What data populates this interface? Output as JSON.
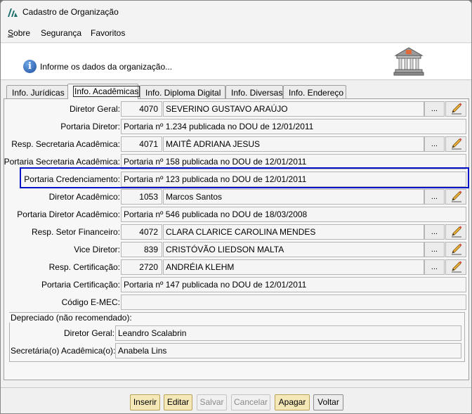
{
  "window": {
    "title": "Cadastro de Organização"
  },
  "menu": [
    "Sobre",
    "Segurança",
    "Favoritos"
  ],
  "header": {
    "info_text": "Informe os dados da organização..."
  },
  "tabs": [
    "Info. Jurídicas",
    "Info. Acadêmicas",
    "Info. Diploma Digital",
    "Info. Diversas",
    "Info. Endereço"
  ],
  "active_tab": "Info. Acadêmicas",
  "fields": {
    "diretor_geral": {
      "label": "Diretor Geral:",
      "code": "4070",
      "name": "SEVERINO GUSTAVO ARAÚJO",
      "lookup_label": "..."
    },
    "portaria_diretor": {
      "label": "Portaria Diretor:",
      "value": "Portaria nº 1.234 publicada no DOU de 12/01/2011"
    },
    "resp_secretaria": {
      "label": "Resp. Secretaria Acadêmica:",
      "code": "4071",
      "name": "MAITÊ ADRIANA JESUS",
      "lookup_label": "..."
    },
    "portaria_secretaria": {
      "label": "Portaria Secretaria Acadêmica:",
      "value": "Portaria nº 158 publicada no DOU de 12/01/2011"
    },
    "portaria_credenciamento": {
      "label": "Portaria Credenciamento:",
      "value": "Portaria nº 123 publicada no DOU de 12/01/2011"
    },
    "diretor_academico": {
      "label": "Diretor Acadêmico:",
      "code": "1053",
      "name": "Marcos Santos",
      "lookup_label": "..."
    },
    "portaria_diretor_academico": {
      "label": "Portaria Diretor Acadêmico:",
      "value": "Portaria nº 546 publicada no DOU de 18/03/2008"
    },
    "resp_setor_financeiro": {
      "label": "Resp. Setor Financeiro:",
      "code": "4072",
      "name": "CLARA CLARICE CAROLINA MENDES",
      "lookup_label": "..."
    },
    "vice_diretor": {
      "label": "Vice Diretor:",
      "code": "839",
      "name": "CRISTÓVÃO LIEDSON MALTA",
      "lookup_label": "..."
    },
    "resp_certificacao": {
      "label": "Resp. Certificação:",
      "code": "2720",
      "name": "ANDRÉIA KLEHM",
      "lookup_label": "..."
    },
    "portaria_certificacao": {
      "label": "Portaria Certificação:",
      "value": "Portaria nº 147 publicada no DOU de 12/01/2011"
    },
    "codigo_emec": {
      "label": "Código E-MEC:",
      "value": ""
    }
  },
  "deprecated": {
    "title": "Depreciado (não recomendado):",
    "diretor_geral": {
      "label": "Diretor Geral:",
      "value": "Leandro Scalabrin"
    },
    "secretaria": {
      "label": "Secretária(o) Acadêmica(o):",
      "value": "Anabela Lins"
    }
  },
  "buttons": {
    "inserir": "Inserir",
    "editar": "Editar",
    "salvar": "Salvar",
    "cancelar": "Cancelar",
    "apagar": "Apagar",
    "voltar": "Voltar"
  },
  "colors": {
    "highlight_border": "#0012c8",
    "primary_button": "#f5e8b7",
    "info_icon": "#1c4fa0"
  },
  "icons": {
    "app": "logo-icon",
    "info": "info-icon",
    "header": "building-icon",
    "edit": "pencil-icon"
  }
}
